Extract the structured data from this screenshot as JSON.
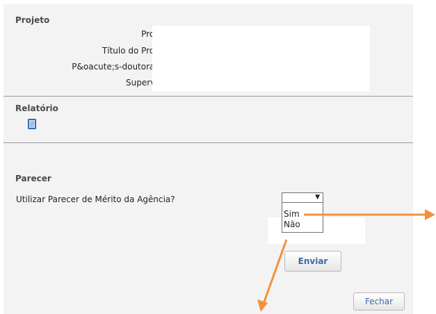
{
  "projeto": {
    "title": "Projeto",
    "labels": [
      "Projeto:",
      "Título do Projeto:",
      "P&oacute;s-doutorando:",
      "Supervisor:"
    ]
  },
  "relatorio": {
    "title": "Relatório",
    "icon": "document-icon"
  },
  "parecer": {
    "title": "Parecer",
    "question": "Utilizar Parecer de Mérito da Agência?",
    "select": {
      "value": "",
      "options": [
        "Sim",
        "Não"
      ]
    }
  },
  "buttons": {
    "enviar": "Enviar",
    "fechar": "Fechar"
  },
  "colors": {
    "accent_arrow": "#f0923e",
    "panel_bg": "#f3f3f3",
    "button_text": "#3a6aa0"
  }
}
